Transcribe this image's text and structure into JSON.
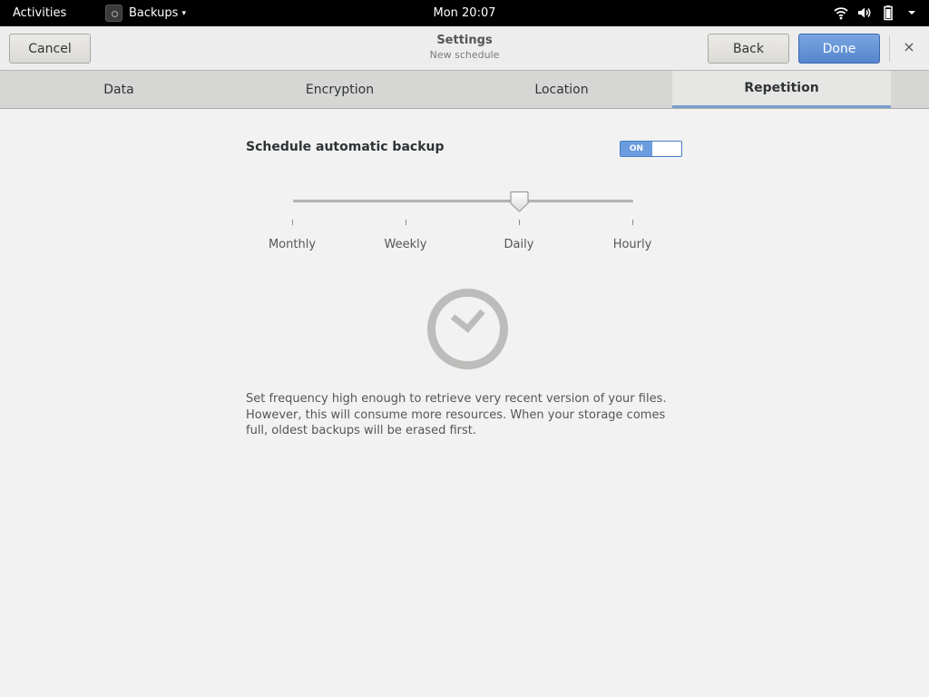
{
  "topbar": {
    "activities": "Activities",
    "app_name": "Backups",
    "clock": "Mon 20:07",
    "icons": [
      "wifi-icon",
      "volume-icon",
      "battery-icon",
      "chevron-down-icon"
    ]
  },
  "header": {
    "cancel_label": "Cancel",
    "title": "Settings",
    "subtitle": "New schedule",
    "back_label": "Back",
    "done_label": "Done",
    "close_label": "×"
  },
  "tabs": [
    {
      "label": "Data",
      "selected": false
    },
    {
      "label": "Encryption",
      "selected": false
    },
    {
      "label": "Location",
      "selected": false
    },
    {
      "label": "Repetition",
      "selected": true
    }
  ],
  "schedule": {
    "label": "Schedule automatic backup",
    "toggle_text": "ON",
    "toggle_on": true
  },
  "frequency": {
    "marks": [
      "Monthly",
      "Weekly",
      "Daily",
      "Hourly"
    ],
    "selected": "Daily",
    "selected_index": 2
  },
  "description": "Set frequency high enough to retrieve very recent version of your files. However, this will consume more resources. When your storage comes full, oldest backups will be erased first.",
  "colors": {
    "accent": "#5585ce",
    "toggle_on": "#6a9cdf",
    "tab_indicator": "#7a9fcf"
  }
}
